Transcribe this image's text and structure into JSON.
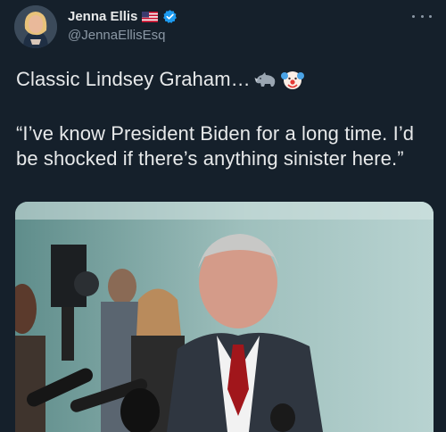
{
  "author": {
    "display_name": "Jenna Ellis",
    "handle": "@JennaEllisEsq",
    "flag_icon": "us-flag-icon",
    "verified_icon": "verified-badge-icon"
  },
  "menu": {
    "icon": "more-horizontal-icon"
  },
  "tweet": {
    "line1": "Classic Lindsey Graham…",
    "emojis": [
      "rhino-emoji",
      "clown-emoji"
    ],
    "quote": "“I’ve know President Biden for a long time. I’d be shocked if there’s anything sinister here.”"
  },
  "colors": {
    "background": "#15202b",
    "text": "#e7e9ea",
    "secondary_text": "#8b98a5",
    "verified_blue": "#1d9bf0"
  }
}
